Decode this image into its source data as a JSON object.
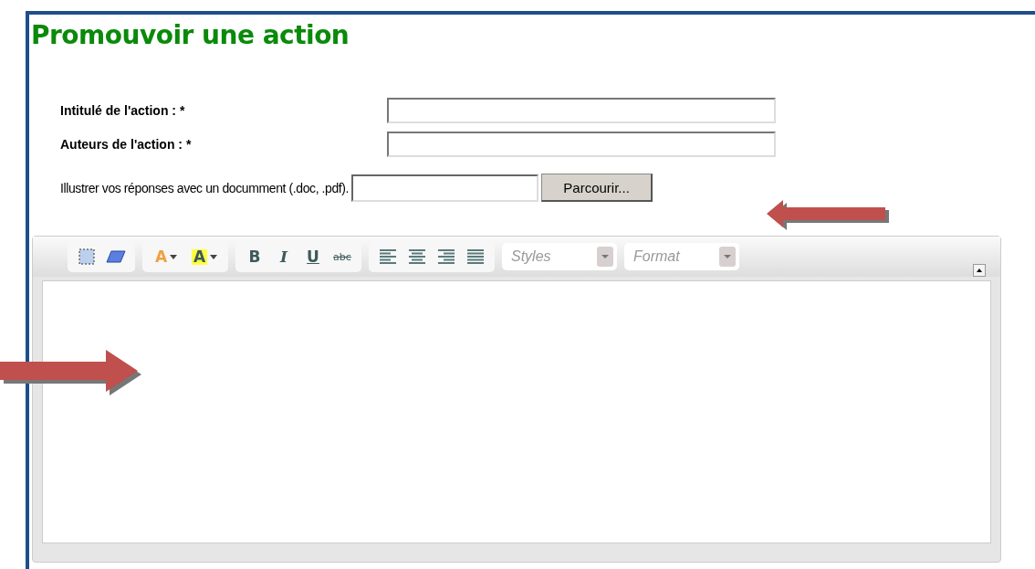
{
  "title": "Promouvoir une action",
  "fields": [
    {
      "label": "Intitulé de l'action : *"
    },
    {
      "label": "Auteurs de l'action : *"
    }
  ],
  "upload": {
    "label": "Illustrer vos réponses avec un documment (.doc, .pdf).",
    "button": "Parcourir..."
  },
  "toolbar": {
    "groups": [
      [
        {
          "kind": "select-all"
        },
        {
          "kind": "eraser"
        }
      ],
      [
        {
          "kind": "text-color",
          "glyph": "A"
        },
        {
          "kind": "bg-color",
          "glyph": "A"
        }
      ],
      [
        {
          "kind": "bold",
          "glyph": "B"
        },
        {
          "kind": "italic",
          "glyph": "I"
        },
        {
          "kind": "underline",
          "glyph": "U"
        },
        {
          "kind": "strike",
          "glyph": "abc"
        }
      ],
      [
        {
          "kind": "align-left"
        },
        {
          "kind": "align-center"
        },
        {
          "kind": "align-right"
        },
        {
          "kind": "justify"
        }
      ]
    ],
    "dropdowns": [
      {
        "placeholder": "Styles"
      },
      {
        "placeholder": "Format"
      }
    ]
  }
}
